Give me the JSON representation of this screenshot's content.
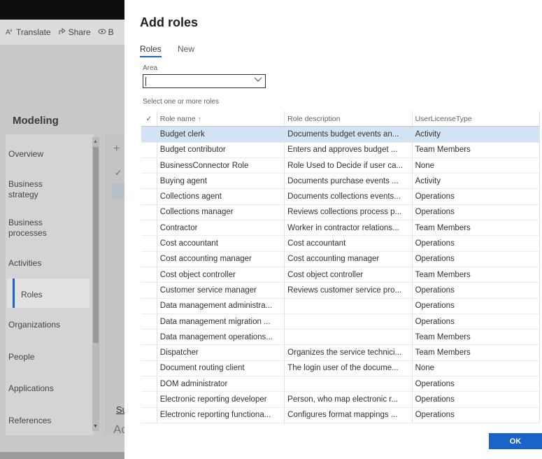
{
  "background": {
    "commands": [
      {
        "label": "Translate",
        "icon": "translate-icon"
      },
      {
        "label": "Share",
        "icon": "share-icon"
      },
      {
        "label": "B",
        "icon": "eye-icon"
      }
    ],
    "title": "Modeling",
    "nav_items": [
      {
        "label": "Overview"
      },
      {
        "label": "Business\nstrategy"
      },
      {
        "label": "Business\nprocesses"
      },
      {
        "label": "Activities"
      },
      {
        "label": "Roles"
      },
      {
        "label": "Organizations"
      },
      {
        "label": "People"
      },
      {
        "label": "Applications"
      },
      {
        "label": "References"
      }
    ],
    "selected_nav": "Roles",
    "tab_fragment": "Su",
    "text_fragment": "Ac"
  },
  "dialog": {
    "title": "Add roles",
    "tabs": [
      {
        "label": "Roles",
        "selected": true
      },
      {
        "label": "New",
        "selected": false
      }
    ],
    "area_label": "Area",
    "area_value": "",
    "select_label": "Select one or more roles",
    "columns": [
      "Role name",
      "Role description",
      "UserLicenseType"
    ],
    "rows": [
      {
        "name": "Budget clerk",
        "description": "Documents budget events an...",
        "license": "Activity",
        "selected": true
      },
      {
        "name": "Budget contributor",
        "description": "Enters and approves budget ...",
        "license": "Team Members"
      },
      {
        "name": "BusinessConnector Role",
        "description": "Role Used to Decide if user ca...",
        "license": "None"
      },
      {
        "name": "Buying agent",
        "description": "Documents purchase events ...",
        "license": "Activity"
      },
      {
        "name": "Collections agent",
        "description": "Documents collections events...",
        "license": "Operations"
      },
      {
        "name": "Collections manager",
        "description": "Reviews collections process p...",
        "license": "Operations"
      },
      {
        "name": "Contractor",
        "description": "Worker in contractor relations...",
        "license": "Team Members"
      },
      {
        "name": "Cost accountant",
        "description": "Cost accountant",
        "license": "Operations"
      },
      {
        "name": "Cost accounting manager",
        "description": "Cost accounting manager",
        "license": "Operations"
      },
      {
        "name": "Cost object controller",
        "description": "Cost object controller",
        "license": "Team Members"
      },
      {
        "name": "Customer service manager",
        "description": "Reviews customer service pro...",
        "license": "Operations"
      },
      {
        "name": "Data management administra...",
        "description": "",
        "license": "Operations"
      },
      {
        "name": "Data management migration ...",
        "description": "",
        "license": "Operations"
      },
      {
        "name": "Data management operations...",
        "description": "",
        "license": "Team Members"
      },
      {
        "name": "Dispatcher",
        "description": "Organizes the service technici...",
        "license": "Team Members"
      },
      {
        "name": "Document routing client",
        "description": "The login user of the docume...",
        "license": "None"
      },
      {
        "name": "DOM administrator",
        "description": "",
        "license": "Operations"
      },
      {
        "name": "Electronic reporting developer",
        "description": "Person, who map electronic r...",
        "license": "Operations"
      },
      {
        "name": "Electronic reporting functiona...",
        "description": "Configures format mappings ...",
        "license": "Operations"
      }
    ],
    "ok_label": "OK"
  },
  "colors": {
    "accent": "#1b63c6",
    "selected_row": "#d2e3f4"
  }
}
